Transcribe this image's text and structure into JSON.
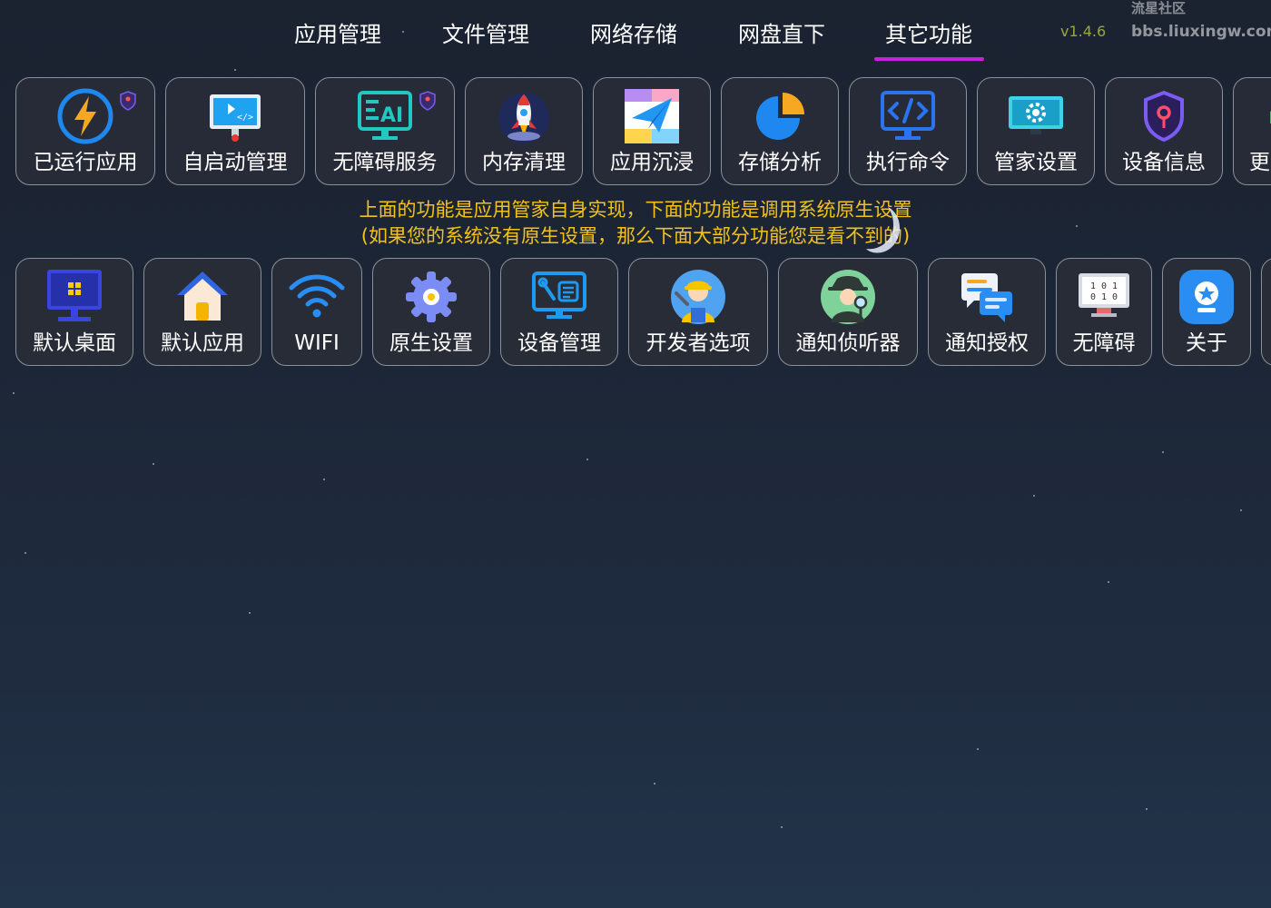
{
  "nav": {
    "tabs": [
      {
        "label": "应用管理"
      },
      {
        "label": "文件管理"
      },
      {
        "label": "网络存储"
      },
      {
        "label": "网盘直下"
      },
      {
        "label": "其它功能",
        "active": true
      }
    ],
    "version": "v1.4.6",
    "watermark_line1": "流星社区",
    "watermark_line2": "bbs.liuxingw.com"
  },
  "row1": [
    {
      "label": "已运行应用",
      "icon": "lightning-icon"
    },
    {
      "label": "自启动管理",
      "icon": "monitor-code-icon"
    },
    {
      "label": "无障碍服务",
      "icon": "ai-screen-icon"
    },
    {
      "label": "内存清理",
      "icon": "rocket-icon"
    },
    {
      "label": "应用沉浸",
      "icon": "paper-plane-icon"
    },
    {
      "label": "存储分析",
      "icon": "pie-chart-icon"
    },
    {
      "label": "执行命令",
      "icon": "code-terminal-icon"
    },
    {
      "label": "管家设置",
      "icon": "settings-screen-icon"
    },
    {
      "label": "设备信息",
      "icon": "shield-key-icon"
    },
    {
      "label": "更",
      "icon": "more-icon"
    }
  ],
  "notice": {
    "line1": "上面的功能是应用管家自身实现，下面的功能是调用系统原生设置",
    "line2": "(如果您的系统没有原生设置，那么下面大部分功能您是看不到的)"
  },
  "row2": [
    {
      "label": "默认桌面",
      "icon": "desktop-icon"
    },
    {
      "label": "默认应用",
      "icon": "home-icon"
    },
    {
      "label": "WIFI",
      "icon": "wifi-icon"
    },
    {
      "label": "原生设置",
      "icon": "gear-icon"
    },
    {
      "label": "设备管理",
      "icon": "device-manage-icon"
    },
    {
      "label": "开发者选项",
      "icon": "developer-worker-icon"
    },
    {
      "label": "通知侦听器",
      "icon": "detective-icon"
    },
    {
      "label": "通知授权",
      "icon": "chat-bubbles-icon"
    },
    {
      "label": "无障碍",
      "icon": "binary-screen-icon"
    },
    {
      "label": "关于",
      "icon": "about-badge-icon"
    }
  ],
  "colors": {
    "accent_underline": "#c91fe0",
    "notice_text": "#f2c21a",
    "version_text": "#9aa83a"
  }
}
